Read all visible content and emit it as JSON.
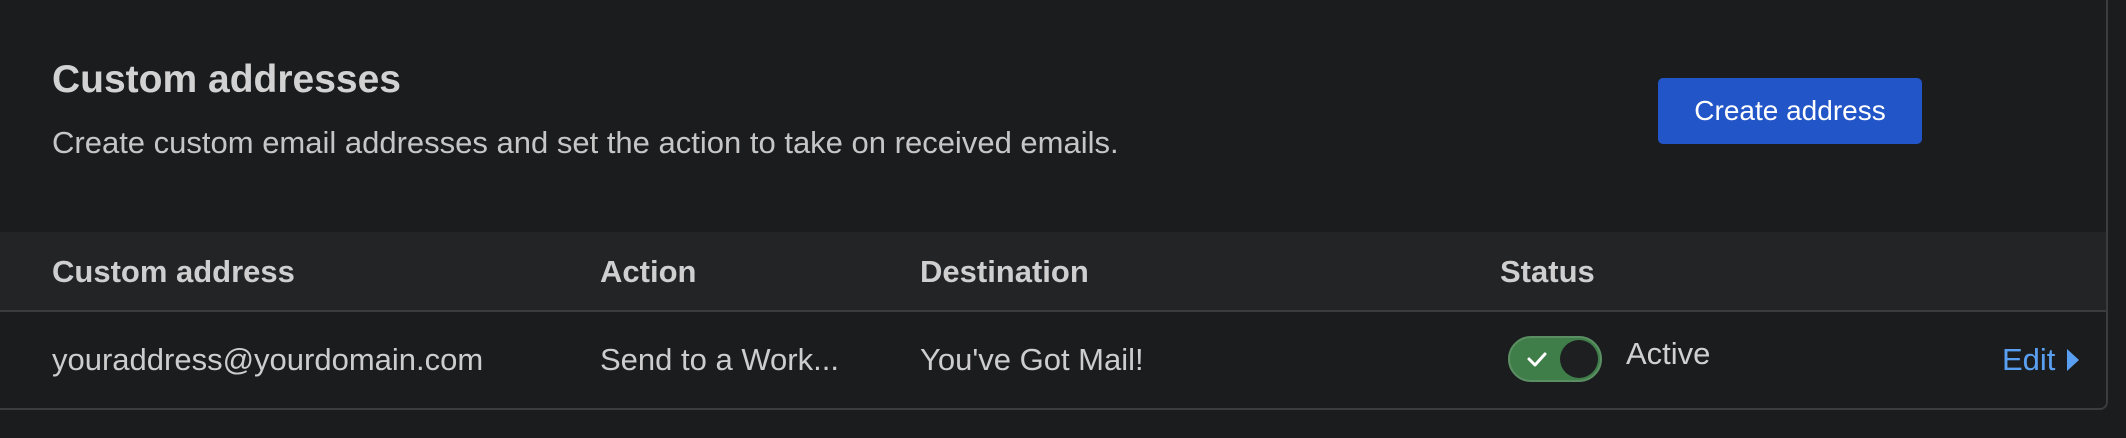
{
  "header": {
    "title": "Custom addresses",
    "subtitle": "Create custom email addresses and set the action to take on received emails.",
    "create_button_label": "Create address"
  },
  "table": {
    "columns": [
      "Custom address",
      "Action",
      "Destination",
      "Status"
    ],
    "rows": [
      {
        "custom_address": "youraddress@yourdomain.com",
        "action": "Send to a Work...",
        "destination": "You've Got Mail!",
        "status_enabled": true,
        "status": "Active",
        "edit_label": "Edit"
      }
    ]
  },
  "colors": {
    "background": "#1b1c1e",
    "header_row": "#232426",
    "primary_button": "#2255c8",
    "toggle_on": "#3f7d49",
    "link": "#5aa0f2"
  },
  "icons": {
    "toggle": "check-icon",
    "edit": "caret-right-icon"
  }
}
